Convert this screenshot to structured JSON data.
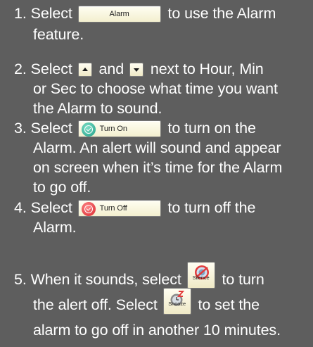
{
  "steps": [
    {
      "number": "1.",
      "pre": "Select",
      "post": "to use the Alarm",
      "cont": "feature.",
      "button_label": "Alarm"
    },
    {
      "number": "2.",
      "pre": "Select",
      "mid": "and",
      "post": "next to Hour, Min",
      "cont1": "or Sec to choose what time you want",
      "cont2": "the Alarm to sound."
    },
    {
      "number": "3.",
      "pre": "Select",
      "post": "to turn on the",
      "cont1": "Alarm. An alert will sound and appear",
      "cont2": "on screen when it’s time for the Alarm",
      "cont3": "to go off.",
      "button_label": "Turn On"
    },
    {
      "number": "4.",
      "pre": "Select",
      "post": "to turn off the",
      "cont": "Alarm.",
      "button_label": "Turn Off"
    },
    {
      "number": "5.",
      "pre": "When it sounds, select",
      "post": "to turn",
      "line2_pre": "the alert off. Select",
      "line2_post": "to set the",
      "cont": "alarm to go off in another 10 minutes.",
      "silence_label": "Silence",
      "snooze_label": "Snooze"
    }
  ],
  "colors": {
    "background": "#5e5e5e",
    "text": "#ffffff",
    "button_face": "#fffef2",
    "turn_on_icon": "#1f9e86",
    "turn_off_icon": "#d8232a"
  },
  "icons": {
    "up_arrow": "up-arrow-icon",
    "down_arrow": "down-arrow-icon",
    "silence": "silence-icon",
    "snooze": "snooze-icon"
  }
}
